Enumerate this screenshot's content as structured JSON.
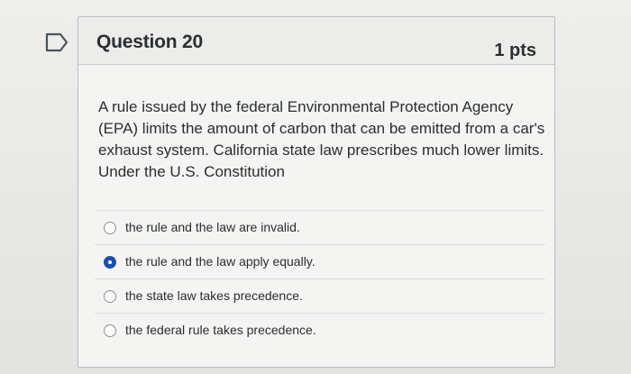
{
  "question": {
    "title": "Question 20",
    "points": "1 pts",
    "flag_icon": "bookmark-flag-icon",
    "text": "A rule issued by the federal Environmental Protection Agency (EPA) limits the amount of carbon that can be emitted from a car's exhaust system. California state law prescribes much lower limits. Under the U.S. Constitution"
  },
  "answers": [
    {
      "label": "the rule and the law are invalid.",
      "selected": false
    },
    {
      "label": "the rule and the law apply equally.",
      "selected": true
    },
    {
      "label": "the state law takes precedence.",
      "selected": false
    },
    {
      "label": "the federal rule takes precedence.",
      "selected": false
    }
  ],
  "colors": {
    "selected_radio": "#1e4fa8",
    "card_border": "#b9bdc0",
    "text": "#2a2e32"
  }
}
